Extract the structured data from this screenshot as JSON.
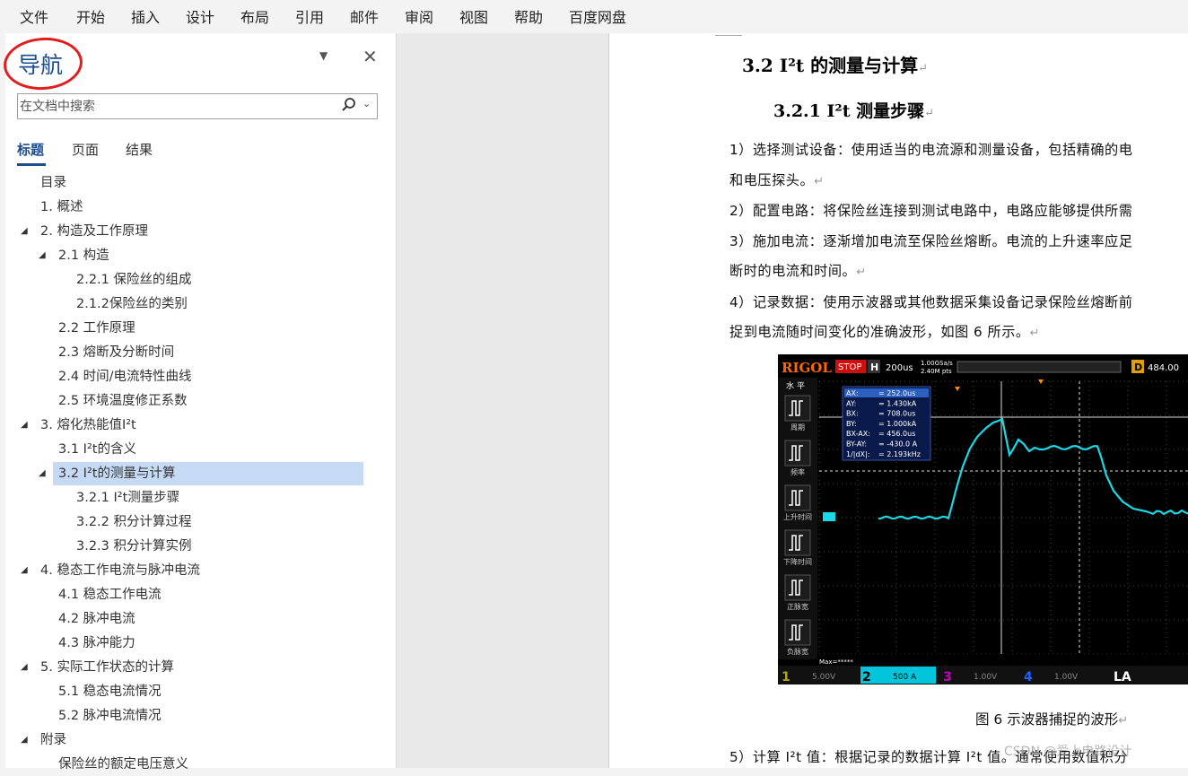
{
  "menu": [
    "文件",
    "开始",
    "插入",
    "设计",
    "布局",
    "引用",
    "邮件",
    "审阅",
    "视图",
    "帮助",
    "百度网盘"
  ],
  "nav": {
    "title": "导航",
    "search_placeholder": "在文档中搜索",
    "tabs": [
      "标题",
      "页面",
      "结果"
    ],
    "items": [
      {
        "label": "目录",
        "level": 1,
        "arrow": false
      },
      {
        "label": "1. 概述",
        "level": 1,
        "arrow": false
      },
      {
        "label": "2. 构造及工作原理",
        "level": 1,
        "arrow": true
      },
      {
        "label": "2.1 构造",
        "level": 2,
        "arrow": true
      },
      {
        "label": "2.2.1 保险丝的组成",
        "level": 3,
        "arrow": false
      },
      {
        "label": "2.1.2保险丝的类别",
        "level": 3,
        "arrow": false
      },
      {
        "label": "2.2 工作原理",
        "level": 2,
        "arrow": false
      },
      {
        "label": "2.3 熔断及分断时间",
        "level": 2,
        "arrow": false
      },
      {
        "label": "2.4 时间/电流特性曲线",
        "level": 2,
        "arrow": false
      },
      {
        "label": "2.5 环境温度修正系数",
        "level": 2,
        "arrow": false
      },
      {
        "label": "3. 熔化热能值I²t",
        "level": 1,
        "arrow": true
      },
      {
        "label": "3.1 I²t的含义",
        "level": 2,
        "arrow": false
      },
      {
        "label": "3.2 I²t的测量与计算",
        "level": 2,
        "arrow": true,
        "selected": true
      },
      {
        "label": "3.2.1 I²t测量步骤",
        "level": 3,
        "arrow": false
      },
      {
        "label": "3.2.2 积分计算过程",
        "level": 3,
        "arrow": false
      },
      {
        "label": "3.2.3 积分计算实例",
        "level": 3,
        "arrow": false
      },
      {
        "label": "4. 稳态工作电流与脉冲电流",
        "level": 1,
        "arrow": true
      },
      {
        "label": "4.1 稳态工作电流",
        "level": 2,
        "arrow": false
      },
      {
        "label": "4.2 脉冲电流",
        "level": 2,
        "arrow": false
      },
      {
        "label": "4.3 脉冲能力",
        "level": 2,
        "arrow": false
      },
      {
        "label": "5. 实际工作状态的计算",
        "level": 1,
        "arrow": true
      },
      {
        "label": "5.1 稳态电流情况",
        "level": 2,
        "arrow": false
      },
      {
        "label": "5.2 脉冲电流情况",
        "level": 2,
        "arrow": false
      },
      {
        "label": "附录",
        "level": 1,
        "arrow": true
      },
      {
        "label": "保险丝的额定电压意义",
        "level": 2,
        "arrow": false
      }
    ]
  },
  "doc": {
    "h2": "3.2  I²t 的测量与计算",
    "h3": "3.2.1  I²t 测量步骤",
    "paragraphs": [
      "1）选择测试设备：使用适当的电流源和测量设备，包括精确的电",
      "和电压探头。",
      "2）配置电路：将保险丝连接到测试电路中，电路应能够提供所需",
      "3）施加电流：逐渐增加电流至保险丝熔断。电流的上升速率应足",
      "断时的电流和时间。",
      "4）记录数据：使用示波器或其他数据采集设备记录保险丝熔断前",
      "捉到电流随时间变化的准确波形，如图 6 所示。"
    ],
    "caption": "图 6 示波器捕捉的波形",
    "last_para": "5）计算 I²t 值：根据记录的数据计算 I²t 值。通常使用数值积分",
    "watermark": "CSDN @爱上电路设计"
  },
  "scope": {
    "brand": "RIGOL",
    "stop": "STOP",
    "h": "H",
    "timebase": "200us",
    "rate": "1.00GSa/s",
    "pts": "2.40M pts",
    "d": "D",
    "d_value": "484.00",
    "horiz_label": "水 平",
    "side": [
      "周期",
      "频率",
      "上升时间",
      "下降时间",
      "正脉宽",
      "负脉宽"
    ],
    "cursor_lines": [
      {
        "k": "AX:",
        "v": "= 252.0us"
      },
      {
        "k": "AY:",
        "v": "= 1.430kA"
      },
      {
        "k": "BX:",
        "v": "= 708.0us"
      },
      {
        "k": "BY:",
        "v": "= 1.000kA"
      },
      {
        "k": "BX-AX:",
        "v": "= 456.0us"
      },
      {
        "k": "BY-AY:",
        "v": "= -430.0 A"
      },
      {
        "k": "1/|dX|:",
        "v": "= 2.193kHz"
      }
    ],
    "max_label": "Max=*****",
    "ch": [
      {
        "n": "1",
        "v": "5.00V",
        "color": "#b8a600"
      },
      {
        "n": "2",
        "v": "500 A",
        "color": "#00e5ff"
      },
      {
        "n": "3",
        "v": "1.00V",
        "color": "#c000c0"
      },
      {
        "n": "4",
        "v": "1.00V",
        "color": "#2060ff"
      }
    ],
    "la": "LA",
    "trace_color": "#19d9e6",
    "cursor_bg": "#0a1a4a"
  }
}
